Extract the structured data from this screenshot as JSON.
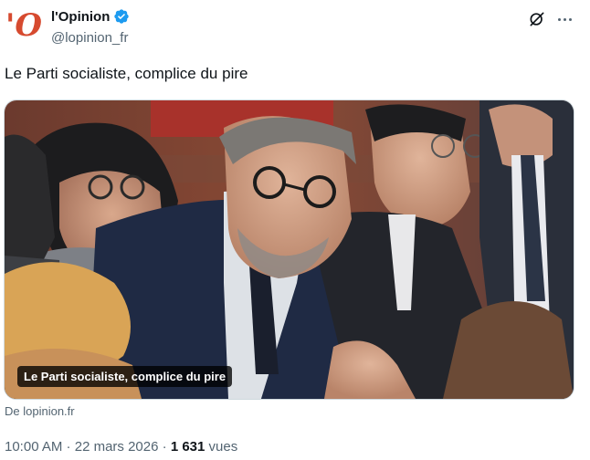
{
  "account": {
    "avatar_glyph": "'O",
    "display_name": "l'Opinion",
    "handle": "@lopinion_fr"
  },
  "icons": {
    "verified": "verified-badge-icon",
    "grok": "grok-icon",
    "more": "more-icon"
  },
  "tweet": {
    "text": "Le Parti socialiste, complice du pire"
  },
  "card": {
    "caption": "Le Parti socialiste, complice du pire",
    "source": "De lopinion.fr"
  },
  "meta": {
    "time": "10:00 AM",
    "separator1": " · ",
    "date": "22 mars 2026",
    "separator2": " · ",
    "views_count": "1 631",
    "views_label": " vues"
  },
  "colors": {
    "brand": "#d64a2f",
    "verified": "#1d9bf0",
    "secondary_text": "#536471"
  }
}
